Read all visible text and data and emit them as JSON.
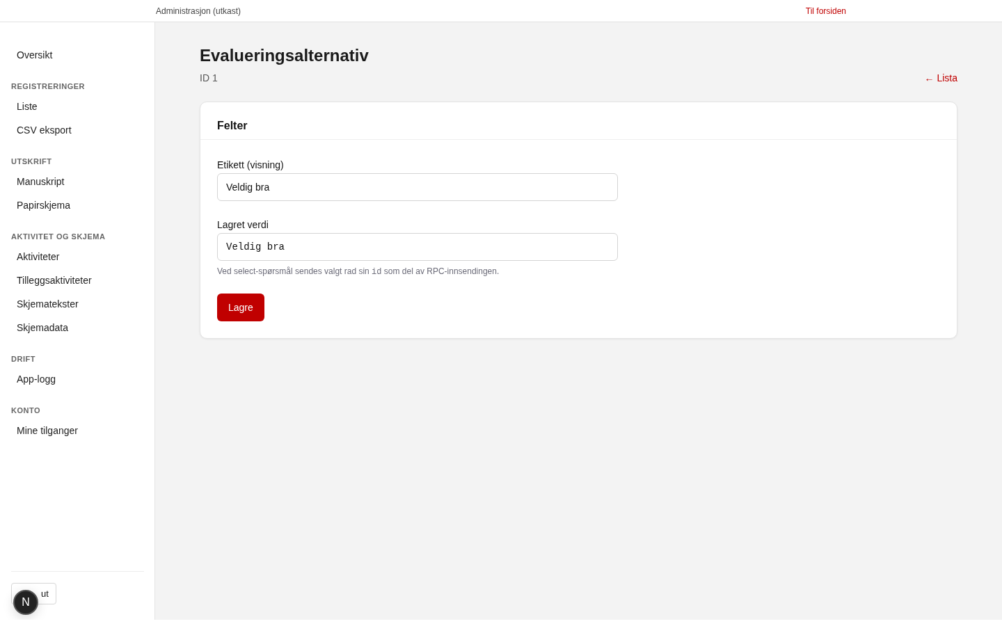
{
  "topbar": {
    "title": "Administrasjon (utkast)",
    "home_link": "Til forsiden"
  },
  "sidebar": {
    "sections": [
      {
        "items": [
          {
            "label": "Oversikt",
            "selected": false
          }
        ]
      },
      {
        "heading": "REGISTRERINGER",
        "items": [
          {
            "label": "Liste",
            "selected": false
          },
          {
            "label": "CSV eksport",
            "selected": false
          }
        ]
      },
      {
        "heading": "UTSKRIFT",
        "items": [
          {
            "label": "Manuskript",
            "selected": false
          },
          {
            "label": "Papirskjema",
            "selected": false
          }
        ]
      },
      {
        "heading": "AKTIVITET OG SKJEMA",
        "items": [
          {
            "label": "Aktiviteter",
            "selected": false
          },
          {
            "label": "Tilleggsaktiviteter",
            "selected": false
          },
          {
            "label": "Skjematekster",
            "selected": false
          },
          {
            "label": "Skjemadata",
            "selected": false
          }
        ]
      },
      {
        "heading": "DRIFT",
        "items": [
          {
            "label": "App-logg",
            "selected": false
          }
        ]
      },
      {
        "heading": "KONTO",
        "items": [
          {
            "label": "Mine tilganger",
            "selected": false
          }
        ]
      }
    ],
    "logout_button": "ut",
    "dev_badge": "N"
  },
  "page": {
    "title": "Evalueringsalternativ",
    "subtitle": "ID 1",
    "back_link": "← Lista"
  },
  "card": {
    "title": "Felter",
    "fields": [
      {
        "label": "Etikett (visning)",
        "value": "Veldig bra",
        "kind": "text"
      },
      {
        "label": "Lagret verdi",
        "value": "Veldig bra",
        "kind": "code"
      }
    ],
    "help": {
      "before": "Ved select-spørsmål sendes valgt rad sin ",
      "code": "id",
      "after": " som del av RPC-innsendingen."
    },
    "save_button": "Lagre"
  }
}
